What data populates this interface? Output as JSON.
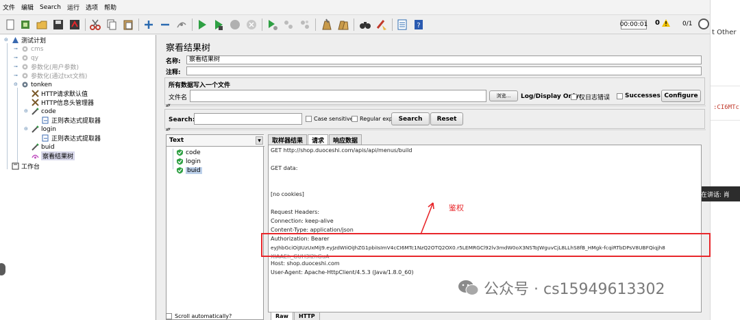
{
  "menu": [
    "文件",
    "编辑",
    "Search",
    "运行",
    "选项",
    "帮助"
  ],
  "status": {
    "timer": "00:00:01",
    "warnings": "0",
    "threads": "0/1"
  },
  "right_strip": {
    "text1": "t Other",
    "code": ":CI6MTc1",
    "speaking": "正在讲话: 肖"
  },
  "tree": [
    {
      "label": "测试计划",
      "disabled": false
    },
    {
      "label": "cms",
      "disabled": true
    },
    {
      "label": "qy",
      "disabled": true
    },
    {
      "label": "参数化(用户参数)",
      "disabled": true
    },
    {
      "label": "参数化(通过txt文档)",
      "disabled": true
    },
    {
      "label": "tonken",
      "disabled": false
    },
    {
      "label": "HTTP请求默认值",
      "disabled": false
    },
    {
      "label": "HTTP信息头管理器",
      "disabled": false
    },
    {
      "label": "code",
      "disabled": false
    },
    {
      "label": "正则表达式提取器",
      "disabled": false
    },
    {
      "label": "login",
      "disabled": false
    },
    {
      "label": "正则表达式提取器",
      "disabled": false
    },
    {
      "label": "buid",
      "disabled": false
    },
    {
      "label": "察看结果树",
      "disabled": false
    },
    {
      "label": "工作台",
      "disabled": false
    }
  ],
  "panel": {
    "title": "察看结果树",
    "name_label": "名称:",
    "name_value": "察看结果树",
    "comment_label": "注释:",
    "write_all_label": "所有数据写入一个文件",
    "filename_label": "文件名",
    "browse_label": "浏览...",
    "log_display_label": "Log/Display Only:",
    "errors_only_label": "仅日志错误",
    "successes_label": "Successes",
    "configure_label": "Configure",
    "search_label": "Search:",
    "case_label": "Case sensitive",
    "regex_label": "Regular exp.",
    "search_button": "Search",
    "reset_button": "Reset"
  },
  "results": {
    "renderer": "Text",
    "samples": [
      "code",
      "login",
      "buid"
    ],
    "scroll_label": "Scroll automatically?",
    "tabs": [
      "取样器结果",
      "请求",
      "响应数据"
    ],
    "active_tab": 1,
    "bottom_tabs": [
      "Raw",
      "HTTP"
    ],
    "lines": [
      "GET http://shop.duoceshi.com/apis/api/menus/build",
      "GET data:",
      "[no cookies]",
      "Request Headers:",
      "Connection: keep-alive",
      "Content-Type: application/json",
      "Authorization: Bearer",
      "eyJhbGciOiJIUzUxMiJ9.eyJzdWIiOiJhZG1pbiIsImV4cCI6MTc1NzQ2OTQ2OX0.r5LEMRGCl92lv3mdW0oX3NSToJWguvCjL8LLhS8fB_HMgk-fcqiRTbDPsV8UBFQiqjh8",
      "XIAAEh_GUH3l2hGuA",
      "Host: shop.duoceshi.com",
      "User-Agent: Apache-HttpClient/4.5.3 (Java/1.8.0_60)"
    ]
  },
  "annotation": "鉴权",
  "watermark": "公众号 · cs15949613302",
  "colors": {
    "highlight": "#e8262a",
    "selection": "#d7d7ea"
  }
}
